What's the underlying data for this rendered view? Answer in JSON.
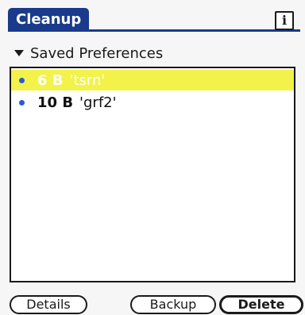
{
  "app": {
    "title": "Cleanup",
    "info_label": "i"
  },
  "category": {
    "label": "Saved Preferences"
  },
  "list": {
    "rows": [
      {
        "size": "6 B",
        "name": "'tsrn'"
      },
      {
        "size": "10 B",
        "name": "'grf2'"
      }
    ]
  },
  "buttons": {
    "details": "Details",
    "backup": "Backup",
    "delete": "Delete"
  },
  "colors": {
    "title_bar": "#1a3a8c",
    "selection": "#f2f24a",
    "bullet": "#2a5bd7"
  }
}
